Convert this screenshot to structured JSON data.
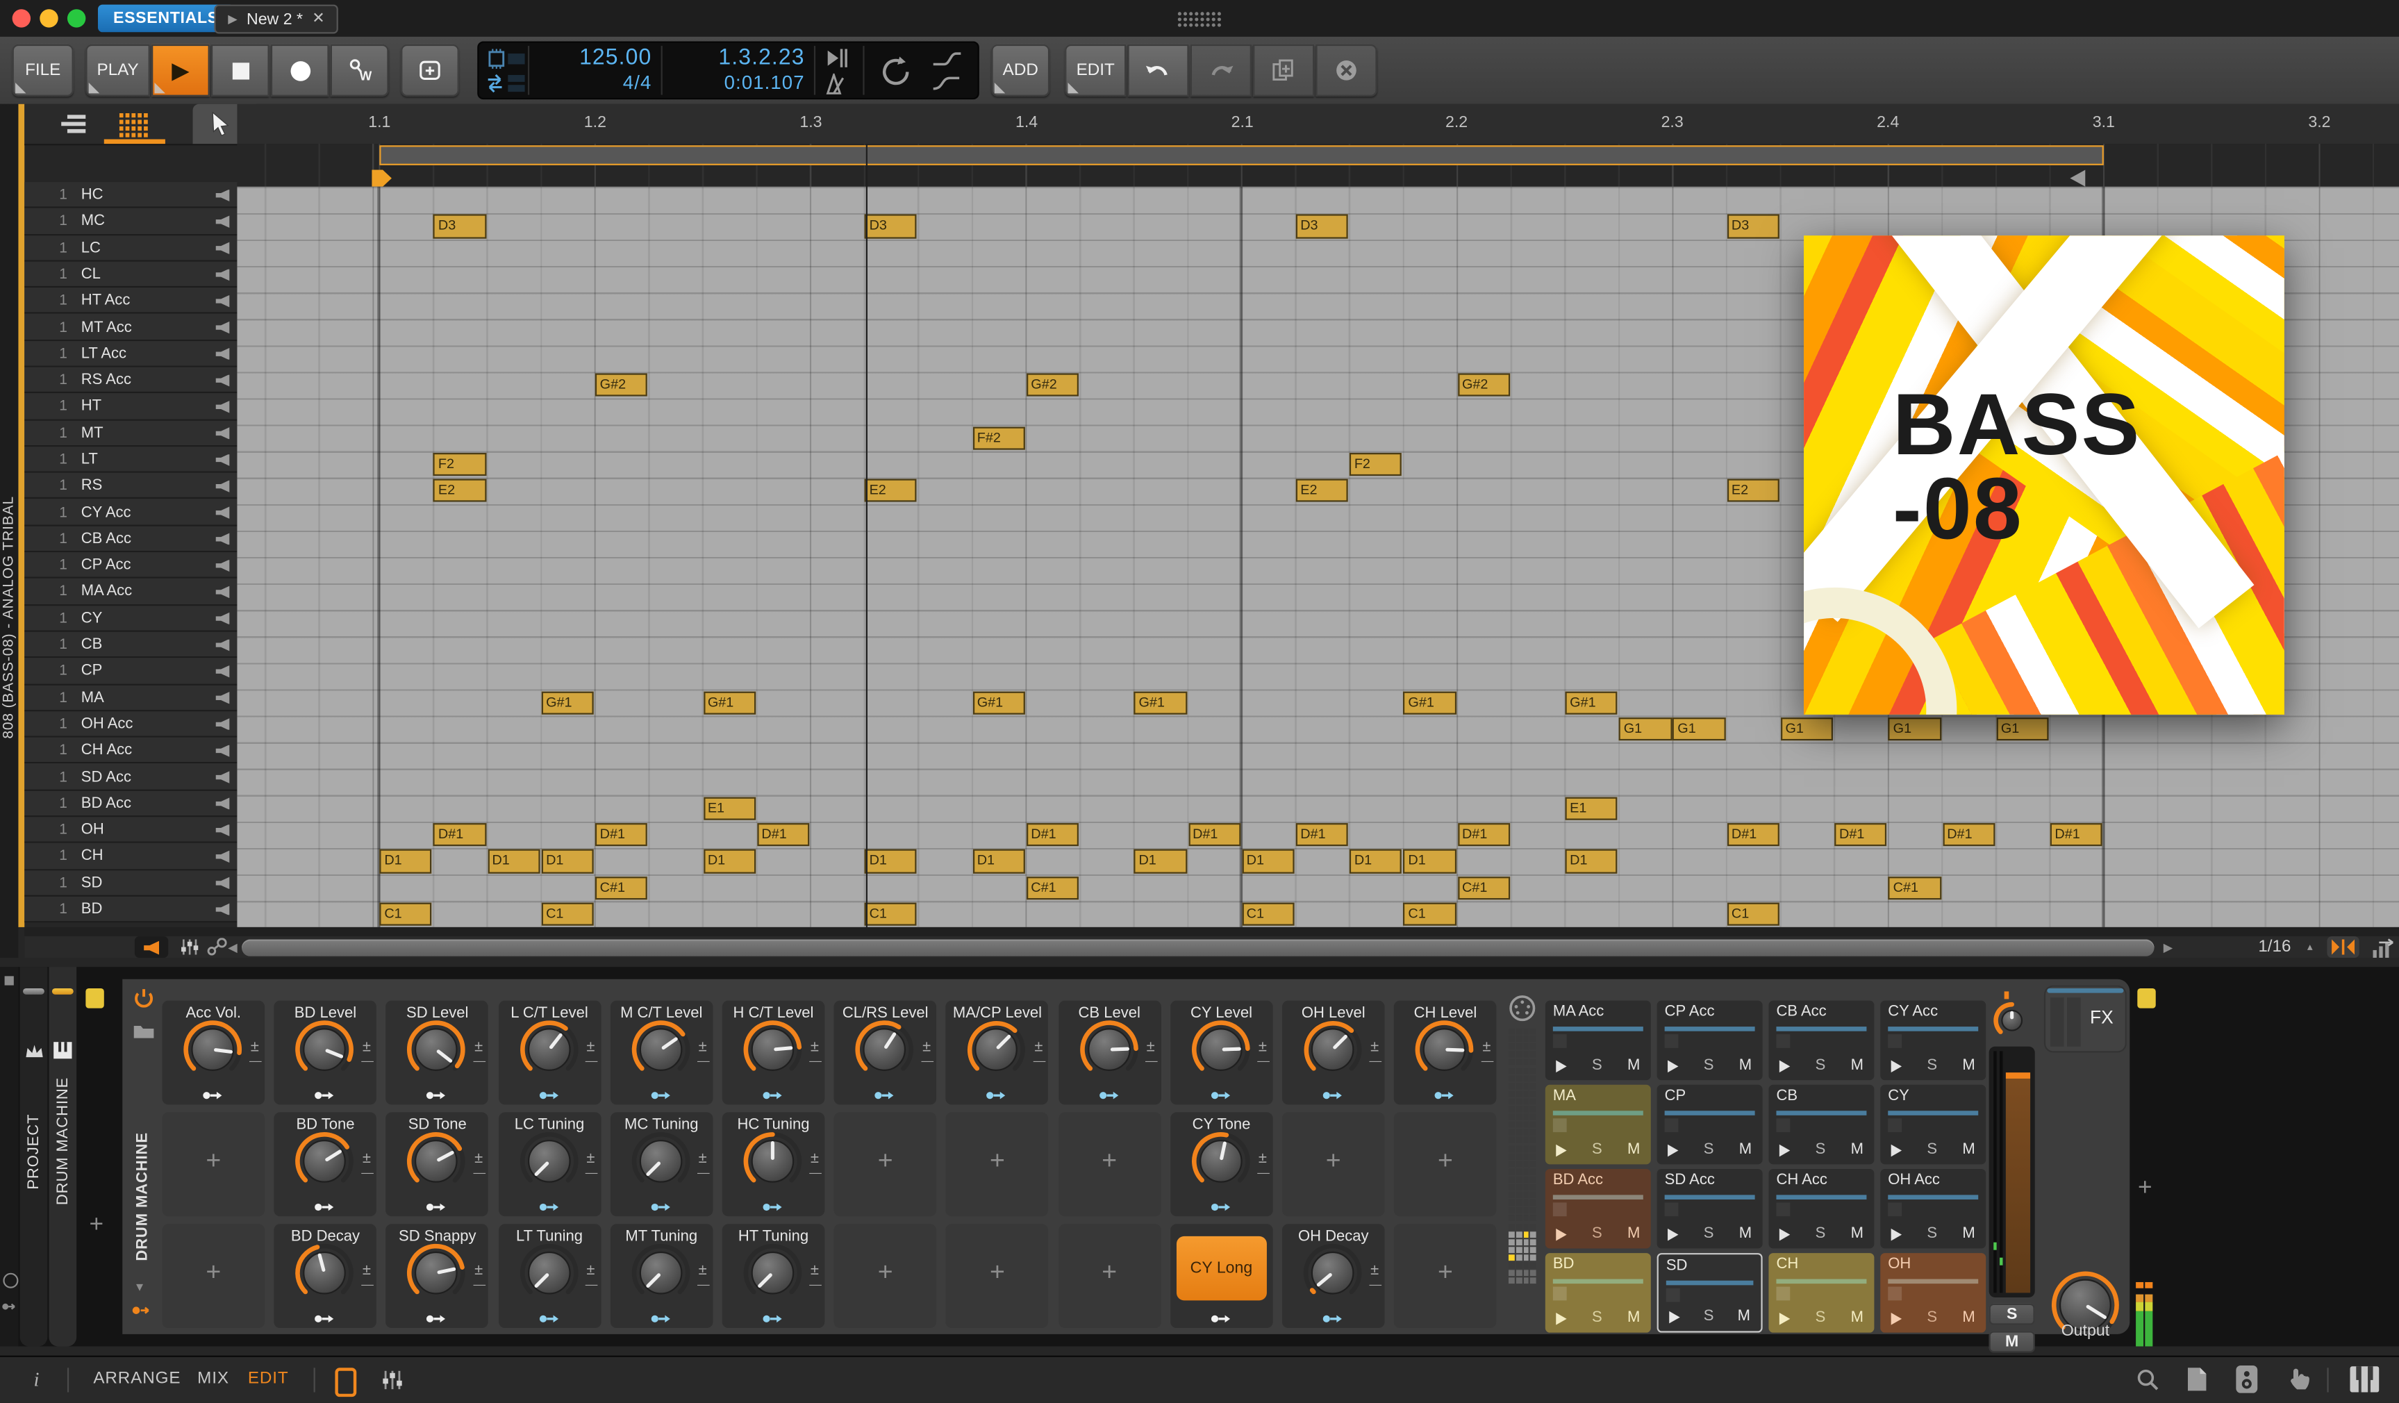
{
  "window": {
    "essentials_label": "ESSENTIALS",
    "doc_tab": "New 2 *",
    "logo_icon": "bitwig-dots-icon",
    "traffic_lights": [
      "close",
      "minimize",
      "zoom"
    ]
  },
  "transport": {
    "file": "FILE",
    "play": "PLAY",
    "add": "ADD",
    "edit": "EDIT",
    "tempo": "125.00",
    "time_sig": "4/4",
    "position": "1.3.2.23",
    "time": "0:01.107",
    "icons": [
      "play-icon",
      "stop-icon",
      "record-icon",
      "automation-write-icon",
      "save-icon",
      "cpu-icon",
      "groove-icon",
      "punch-icon",
      "metronome-icon",
      "loop-icon",
      "ramp-icon",
      "curve-icon",
      "undo-icon",
      "redo-icon",
      "duplicate-icon",
      "delete-icon"
    ]
  },
  "editor": {
    "vertical_label": "808 (BASS-08) - ANALOG TRIBAL",
    "snap": "1/16",
    "track_number": "1",
    "ruler": [
      [
        "1.1",
        248
      ],
      [
        "1.2",
        389
      ],
      [
        "1.3",
        530
      ],
      [
        "1.4",
        671
      ],
      [
        "2.1",
        812
      ],
      [
        "2.2",
        952
      ],
      [
        "2.3",
        1093
      ],
      [
        "2.4",
        1234
      ],
      [
        "3.1",
        1375
      ],
      [
        "3.2",
        1516
      ]
    ],
    "tracks": [
      "HC",
      "MC",
      "LC",
      "CL",
      "HT Acc",
      "MT Acc",
      "LT Acc",
      "RS Acc",
      "HT",
      "MT",
      "LT",
      "RS",
      "CY Acc",
      "CB Acc",
      "CP Acc",
      "MA Acc",
      "CY",
      "CB",
      "CP",
      "MA",
      "OH Acc",
      "CH Acc",
      "SD Acc",
      "BD Acc",
      "OH",
      "CH",
      "SD",
      "BD"
    ],
    "notes": [
      [
        1,
        1,
        "D3"
      ],
      [
        1,
        9,
        "D3"
      ],
      [
        1,
        17,
        "D3"
      ],
      [
        1,
        25,
        "D3"
      ],
      [
        7,
        4,
        "G#2"
      ],
      [
        7,
        12,
        "G#2"
      ],
      [
        7,
        20,
        "G#2"
      ],
      [
        9,
        11,
        "F#2"
      ],
      [
        10,
        1,
        "F2"
      ],
      [
        10,
        18,
        "F2"
      ],
      [
        11,
        1,
        "E2"
      ],
      [
        11,
        9,
        "E2"
      ],
      [
        11,
        17,
        "E2"
      ],
      [
        11,
        25,
        "E2"
      ],
      [
        19,
        3,
        "G#1"
      ],
      [
        19,
        6,
        "G#1"
      ],
      [
        19,
        11,
        "G#1"
      ],
      [
        19,
        14,
        "G#1"
      ],
      [
        19,
        19,
        "G#1"
      ],
      [
        19,
        22,
        "G#1"
      ],
      [
        20,
        23,
        "G1"
      ],
      [
        20,
        24,
        "G1"
      ],
      [
        20,
        26,
        "G1"
      ],
      [
        20,
        28,
        "G1"
      ],
      [
        20,
        30,
        "G1"
      ],
      [
        23,
        6,
        "E1"
      ],
      [
        23,
        22,
        "E1"
      ],
      [
        24,
        1,
        "D#1"
      ],
      [
        24,
        4,
        "D#1"
      ],
      [
        24,
        7,
        "D#1"
      ],
      [
        24,
        12,
        "D#1"
      ],
      [
        24,
        15,
        "D#1"
      ],
      [
        24,
        17,
        "D#1"
      ],
      [
        24,
        20,
        "D#1"
      ],
      [
        24,
        25,
        "D#1"
      ],
      [
        24,
        27,
        "D#1"
      ],
      [
        24,
        29,
        "D#1"
      ],
      [
        24,
        31,
        "D#1"
      ],
      [
        25,
        0,
        "D1"
      ],
      [
        25,
        2,
        "D1"
      ],
      [
        25,
        3,
        "D1"
      ],
      [
        25,
        6,
        "D1"
      ],
      [
        25,
        9,
        "D1"
      ],
      [
        25,
        11,
        "D1"
      ],
      [
        25,
        14,
        "D1"
      ],
      [
        25,
        16,
        "D1"
      ],
      [
        25,
        18,
        "D1"
      ],
      [
        25,
        19,
        "D1"
      ],
      [
        25,
        22,
        "D1"
      ],
      [
        26,
        4,
        "C#1"
      ],
      [
        26,
        12,
        "C#1"
      ],
      [
        26,
        20,
        "C#1"
      ],
      [
        26,
        28,
        "C#1"
      ],
      [
        27,
        0,
        "C1"
      ],
      [
        27,
        3,
        "C1"
      ],
      [
        27,
        9,
        "C1"
      ],
      [
        27,
        16,
        "C1"
      ],
      [
        27,
        19,
        "C1"
      ],
      [
        27,
        25,
        "C1"
      ]
    ]
  },
  "album": {
    "line1": "BASS",
    "line2": "-08"
  },
  "device": {
    "rail_project": "PROJECT",
    "rail_drum_machine": "DRUM MACHINE",
    "device_name": "DRUM MACHINE",
    "fx_label": "FX",
    "output_label": "Output",
    "solo": "S",
    "mute": "M",
    "accent_orange": "#f2831c",
    "mod_blue": "#8fd2f0",
    "pad_yellow": "#ffd428",
    "knob_rows": [
      [
        {
          "t": "k",
          "label": "Acc Vol.",
          "angle": 97,
          "mod": "white"
        },
        {
          "t": "k",
          "label": "BD Level",
          "angle": 112,
          "mod": "white"
        },
        {
          "t": "k",
          "label": "SD Level",
          "angle": 128,
          "mod": "white"
        },
        {
          "t": "k",
          "label": "L C/T Level",
          "angle": 38,
          "mod": "blue"
        },
        {
          "t": "k",
          "label": "M C/T Level",
          "angle": 55,
          "mod": "blue"
        },
        {
          "t": "k",
          "label": "H C/T Level",
          "angle": 85,
          "mod": "blue"
        },
        {
          "t": "k",
          "label": "CL/RS Level",
          "angle": 33,
          "mod": "blue"
        },
        {
          "t": "k",
          "label": "MA/CP Level",
          "angle": 45,
          "mod": "blue"
        },
        {
          "t": "k",
          "label": "CB Level",
          "angle": 88,
          "mod": "blue"
        },
        {
          "t": "k",
          "label": "CY Level",
          "angle": 88,
          "mod": "blue"
        },
        {
          "t": "k",
          "label": "OH Level",
          "angle": 45,
          "mod": "blue"
        },
        {
          "t": "k",
          "label": "CH Level",
          "angle": 92,
          "mod": "blue"
        }
      ],
      [
        {
          "t": "e"
        },
        {
          "t": "k",
          "label": "BD Tone",
          "angle": 58,
          "mod": "white"
        },
        {
          "t": "k",
          "label": "SD Tone",
          "angle": 62,
          "mod": "white"
        },
        {
          "t": "k",
          "label": "LC Tuning",
          "angle": -135,
          "mod": "blue"
        },
        {
          "t": "k",
          "label": "MC Tuning",
          "angle": -135,
          "mod": "blue"
        },
        {
          "t": "k",
          "label": "HC Tuning",
          "angle": 0,
          "mod": "blue"
        },
        {
          "t": "e"
        },
        {
          "t": "e"
        },
        {
          "t": "e"
        },
        {
          "t": "k",
          "label": "CY Tone",
          "angle": 12,
          "mod": "blue"
        },
        {
          "t": "e"
        },
        {
          "t": "e"
        }
      ],
      [
        {
          "t": "e"
        },
        {
          "t": "k",
          "label": "BD Decay",
          "angle": -15,
          "mod": "white"
        },
        {
          "t": "k",
          "label": "SD Snappy",
          "angle": 78,
          "mod": "white"
        },
        {
          "t": "k",
          "label": "LT Tuning",
          "angle": -135,
          "mod": "blue"
        },
        {
          "t": "k",
          "label": "MT Tuning",
          "angle": -135,
          "mod": "blue"
        },
        {
          "t": "k",
          "label": "HT Tuning",
          "angle": -135,
          "mod": "blue"
        },
        {
          "t": "e"
        },
        {
          "t": "e"
        },
        {
          "t": "e"
        },
        {
          "t": "b",
          "label": "CY Long",
          "mod": "white"
        },
        {
          "t": "k",
          "label": "OH Decay",
          "angle": -130,
          "mod": "blue"
        },
        {
          "t": "e"
        }
      ]
    ],
    "pads": [
      {
        "label": "MA Acc",
        "style": "default"
      },
      {
        "label": "CP Acc",
        "style": "default"
      },
      {
        "label": "CB Acc",
        "style": "default"
      },
      {
        "label": "CY Acc",
        "style": "default"
      },
      {
        "label": "MA",
        "style": "olive"
      },
      {
        "label": "CP",
        "style": "default"
      },
      {
        "label": "CB",
        "style": "default"
      },
      {
        "label": "CY",
        "style": "default"
      },
      {
        "label": "BD Acc",
        "style": "brown"
      },
      {
        "label": "SD Acc",
        "style": "default"
      },
      {
        "label": "CH Acc",
        "style": "default"
      },
      {
        "label": "OH Acc",
        "style": "default"
      },
      {
        "label": "BD",
        "style": "olive2"
      },
      {
        "label": "SD",
        "style": "selected"
      },
      {
        "label": "CH",
        "style": "olive2"
      },
      {
        "label": "OH",
        "style": "brown2"
      }
    ]
  },
  "scroll_row": {
    "left_icons": [
      "audition-speaker-icon",
      "mixer-icon",
      "link-icon"
    ],
    "snap_value": "1/16"
  },
  "status": {
    "info": "i",
    "tabs": [
      "ARRANGE",
      "MIX",
      "EDIT"
    ],
    "active_tab": "EDIT",
    "left_icons": [
      "detail-panel-icon",
      "mixer-small-icon"
    ],
    "right_icons": [
      "search-icon",
      "file-icon",
      "monitor-icon",
      "touch-icon",
      "piano-icon"
    ]
  }
}
